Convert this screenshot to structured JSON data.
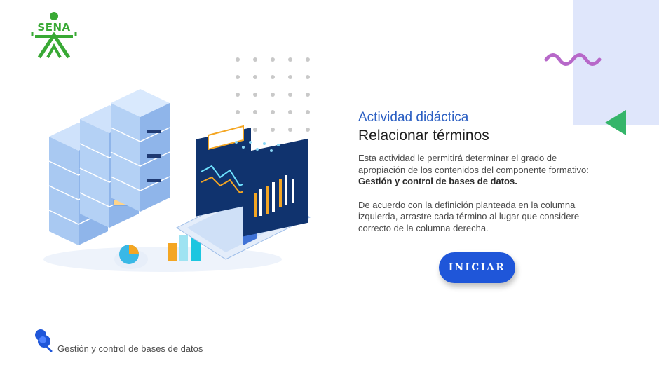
{
  "brand": {
    "logo_text": "SENA",
    "color": "#39a935"
  },
  "activity": {
    "kicker": "Actividad didáctica",
    "title": "Relacionar términos",
    "intro": "Esta actividad le permitirá determinar el grado de apropiación de los contenidos del componente formativo:",
    "component_name": "Gestión y control de bases de datos.",
    "instructions": "De acuerdo con la definición planteada en la columna izquierda, arrastre cada término al lugar que considere correcto de la columna derecha."
  },
  "start_button": {
    "label": "INICIAR"
  },
  "footer": {
    "course_name": "Gestión y control de bases de datos"
  },
  "colors": {
    "accent_blue": "#1f56d9",
    "heading_blue": "#2b5fc3",
    "panel": "#dfe6fb",
    "wave": "#b768c9",
    "triangle": "#35b56a"
  },
  "icons": {
    "logo": "sena-logo-icon",
    "illustration": "database-servers-laptop-illustration",
    "footer": "pin-icon"
  }
}
